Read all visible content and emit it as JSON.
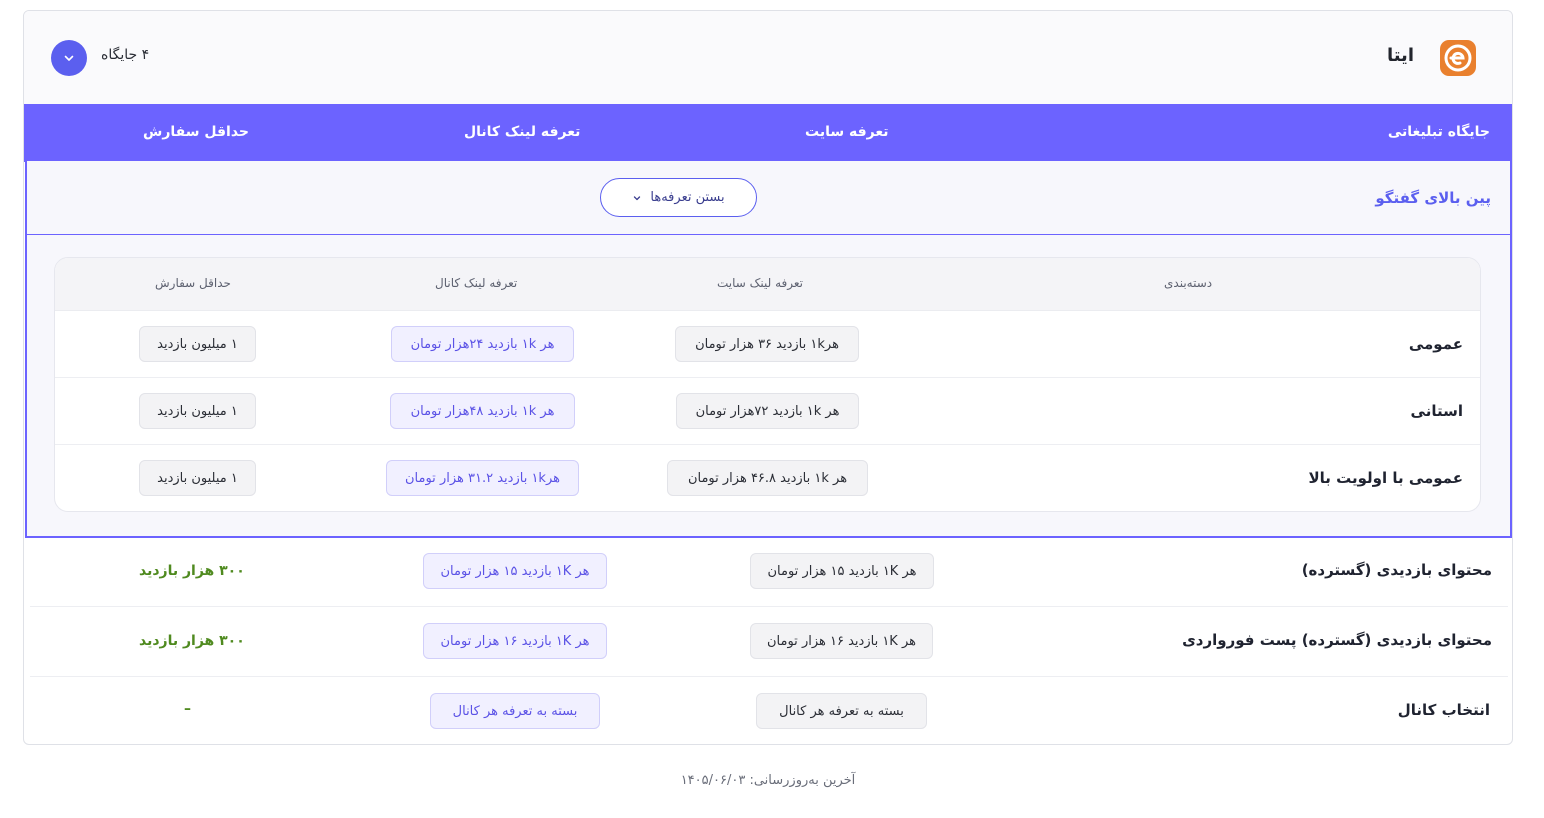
{
  "header": {
    "brand_name": "ایتا",
    "slot_count": "۴ جایگاه",
    "colors": {
      "accent": "#6c63ff",
      "logo": "#e9802e"
    },
    "icons": {
      "logo": "eitaa-logo-icon",
      "toggle": "chevron-down-icon"
    }
  },
  "columns": [
    "جایگاه تبلیغاتی",
    "تعرفه سایت",
    "تعرفه لینک کانال",
    "حداقل سفارش"
  ],
  "pin_section": {
    "title": "پین بالای گفتگو",
    "close_label": "بستن تعرفه‌ها",
    "sub_columns": [
      "دسته‌بندی",
      "تعرفه لینک سایت",
      "تعرفه لینک کانال",
      "حداقل سفارش"
    ],
    "rows": [
      {
        "category": "عمومی",
        "site": "هر۱k بازدید ۳۶ هزار تومان",
        "channel": "هر ۱k بازدید ۲۴هزار تومان",
        "min": "۱ میلیون بازدید"
      },
      {
        "category": "استانی",
        "site": "هر ۱k بازدید ۷۲هزار تومان",
        "channel": "هر ۱k بازدید ۴۸هزار تومان",
        "min": "۱ میلیون بازدید"
      },
      {
        "category": "عمومی با اولویت بالا",
        "site": "هر ۱k بازدید ۴۶.۸ هزار تومان",
        "channel": "هر۱k بازدید ۳۱.۲ هزار تومان",
        "min": "۱ میلیون بازدید"
      }
    ]
  },
  "rows": [
    {
      "name": "محتوای بازدیدی (گسترده)",
      "site": "هر ۱K بازدید ۱۵ هزار تومان",
      "channel": "هر ۱K بازدید ۱۵ هزار تومان",
      "min": "۳۰۰ هزار بازدید"
    },
    {
      "name": "محتوای بازدیدی (گسترده) پست فورواردی",
      "site": "هر ۱K بازدید ۱۶ هزار تومان",
      "channel": "هر ۱K بازدید ۱۶ هزار تومان",
      "min": "۳۰۰ هزار بازدید"
    },
    {
      "name": "انتخاب کانال",
      "site": "بسته به تعرفه هر کانال",
      "channel": "بسته به تعرفه هر کانال",
      "min": "–"
    }
  ],
  "footer": {
    "last_update": "آخرین به‌روزرسانی: ۱۴۰۵/۰۶/۰۳"
  }
}
